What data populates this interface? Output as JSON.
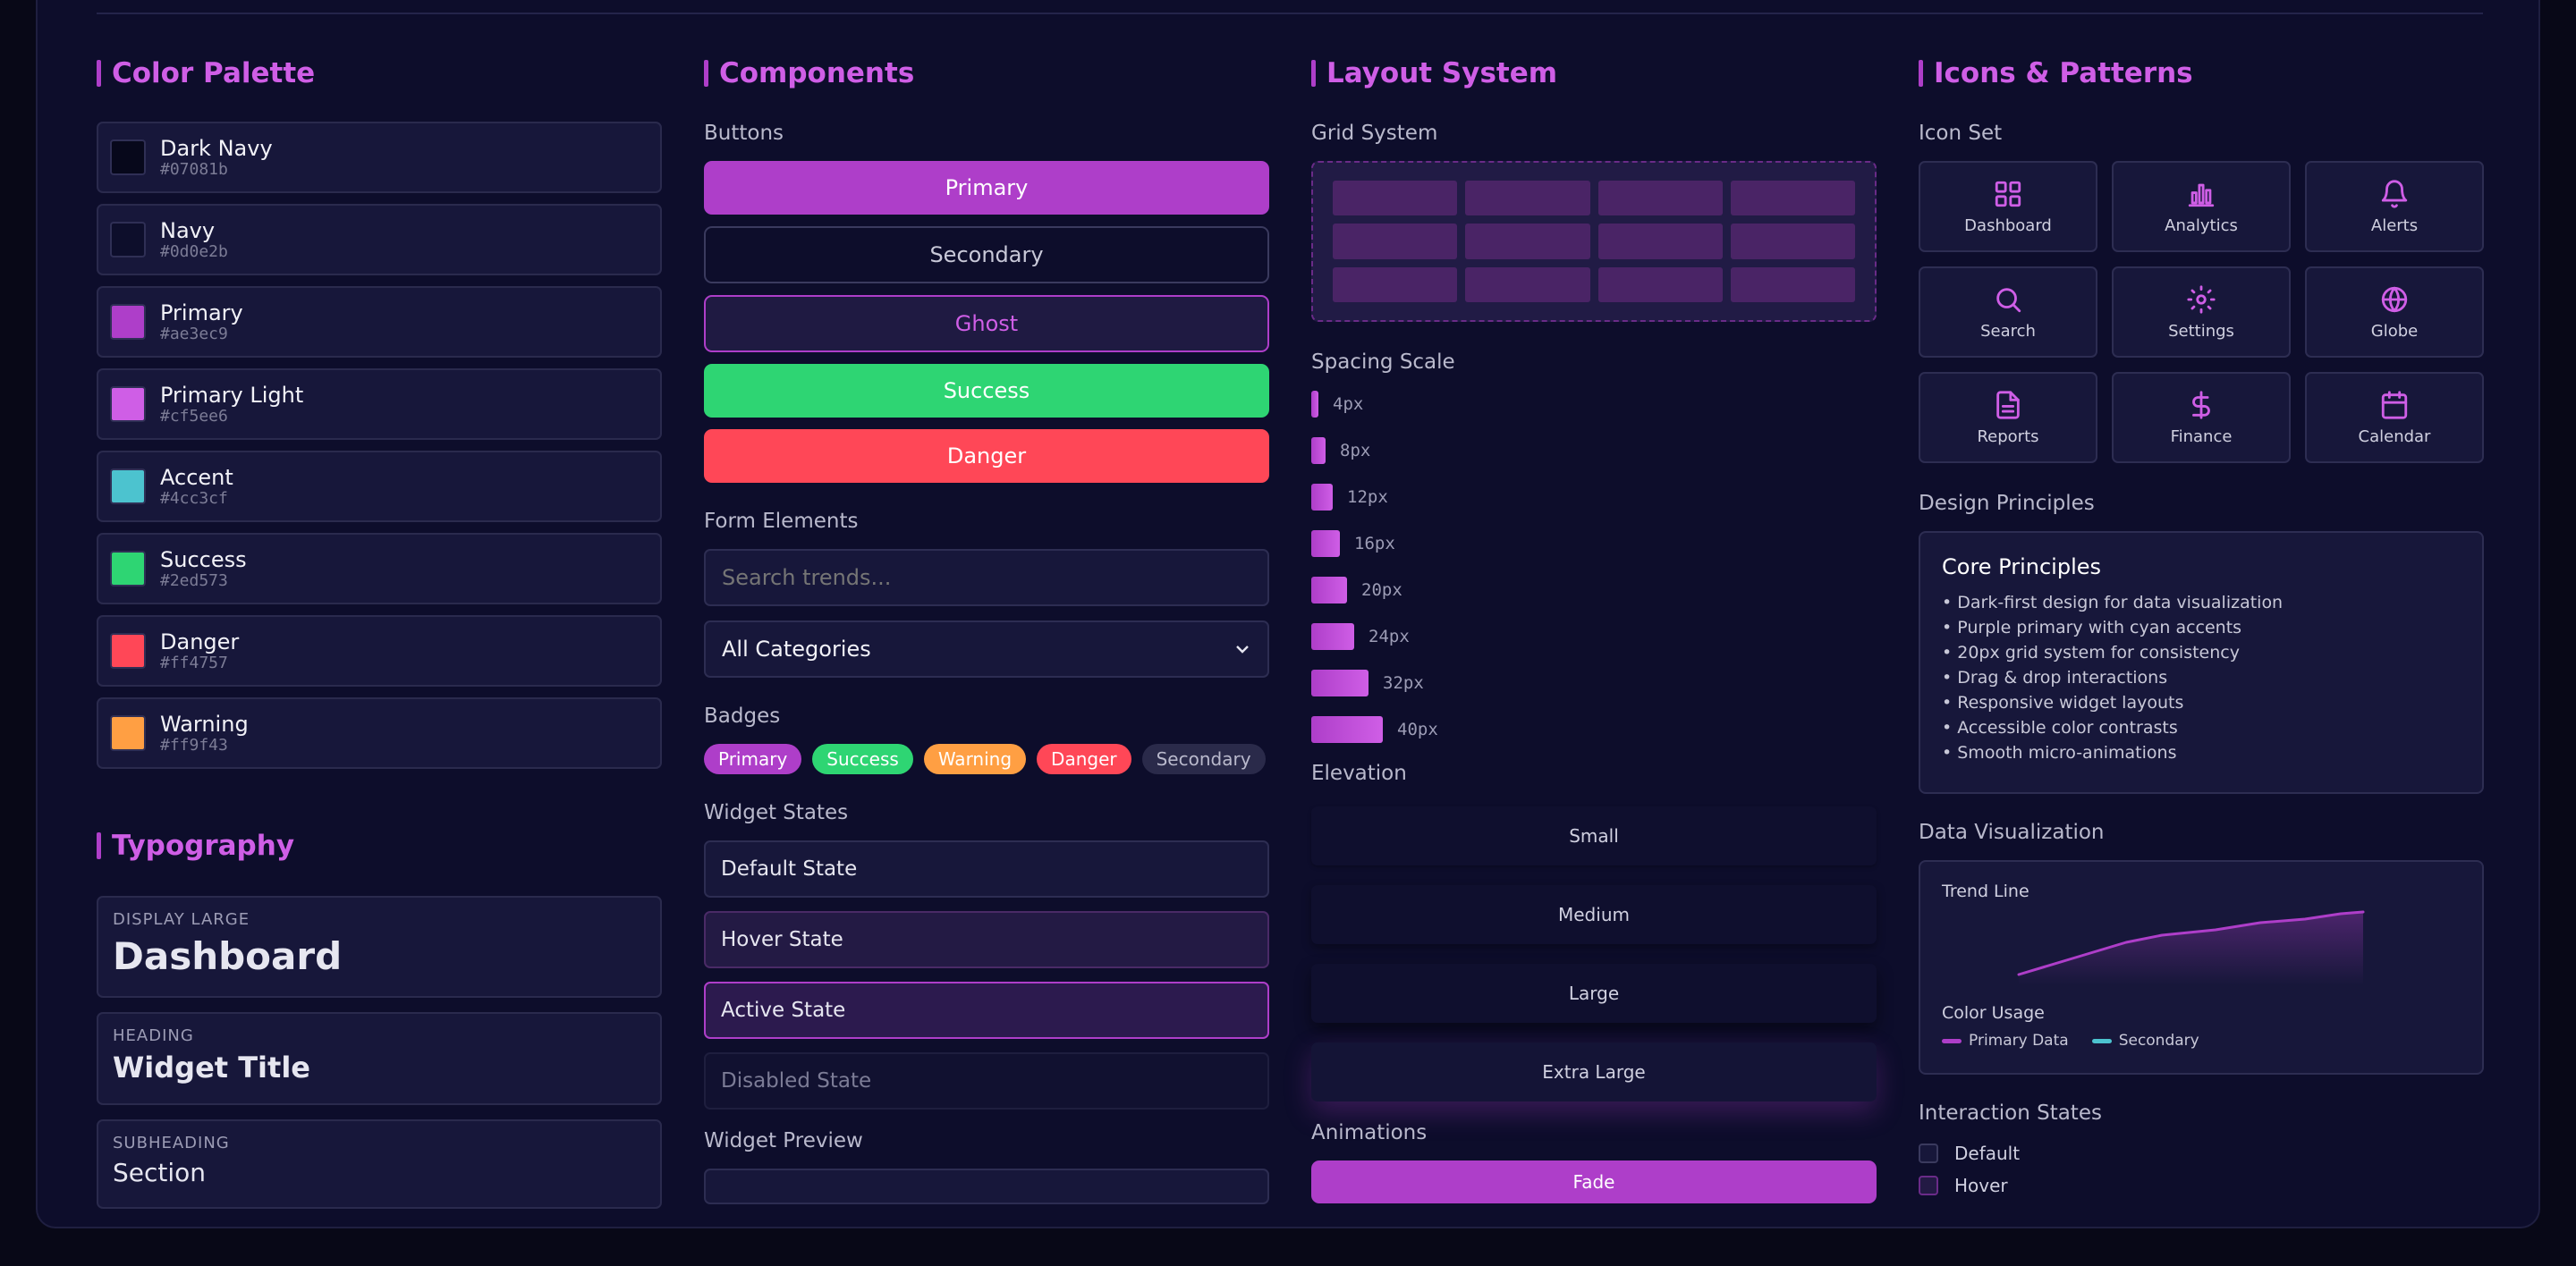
{
  "palette": {
    "title": "Color Palette",
    "swatches": [
      {
        "name": "Dark Navy",
        "hex": "#07081b"
      },
      {
        "name": "Navy",
        "hex": "#0d0e2b"
      },
      {
        "name": "Primary",
        "hex": "#ae3ec9"
      },
      {
        "name": "Primary Light",
        "hex": "#cf5ee6"
      },
      {
        "name": "Accent",
        "hex": "#4cc3cf"
      },
      {
        "name": "Success",
        "hex": "#2ed573"
      },
      {
        "name": "Danger",
        "hex": "#ff4757"
      },
      {
        "name": "Warning",
        "hex": "#ff9f43"
      }
    ]
  },
  "typography": {
    "title": "Typography",
    "samples": [
      {
        "label": "DISPLAY LARGE",
        "text": "Dashboard"
      },
      {
        "label": "HEADING",
        "text": "Widget Title"
      },
      {
        "label": "SUBHEADING",
        "text": "Section"
      }
    ]
  },
  "components": {
    "title": "Components",
    "buttons_label": "Buttons",
    "buttons": [
      "Primary",
      "Secondary",
      "Ghost",
      "Success",
      "Danger"
    ],
    "form_label": "Form Elements",
    "search_placeholder": "Search trends...",
    "select_value": "All Categories",
    "badges_label": "Badges",
    "badges": [
      "Primary",
      "Success",
      "Warning",
      "Danger",
      "Secondary"
    ],
    "states_label": "Widget States",
    "states": [
      "Default State",
      "Hover State",
      "Active State",
      "Disabled State"
    ],
    "preview_label": "Widget Preview"
  },
  "layout": {
    "title": "Layout System",
    "grid_label": "Grid System",
    "spacing_label": "Spacing Scale",
    "spacing": [
      "4px",
      "8px",
      "12px",
      "16px",
      "20px",
      "24px",
      "32px",
      "40px"
    ],
    "elevation_label": "Elevation",
    "elevation": [
      "Small",
      "Medium",
      "Large",
      "Extra Large"
    ],
    "animations_label": "Animations",
    "animation_button": "Fade"
  },
  "icons": {
    "title": "Icons & Patterns",
    "set_label": "Icon Set",
    "items": [
      {
        "label": "Dashboard",
        "icon": "dashboard-icon"
      },
      {
        "label": "Analytics",
        "icon": "analytics-icon"
      },
      {
        "label": "Alerts",
        "icon": "bell-icon"
      },
      {
        "label": "Search",
        "icon": "search-icon"
      },
      {
        "label": "Settings",
        "icon": "gear-icon"
      },
      {
        "label": "Globe",
        "icon": "globe-icon"
      },
      {
        "label": "Reports",
        "icon": "file-icon"
      },
      {
        "label": "Finance",
        "icon": "dollar-icon"
      },
      {
        "label": "Calendar",
        "icon": "calendar-icon"
      }
    ],
    "principles_label": "Design Principles",
    "principles_title": "Core Principles",
    "principles": [
      "• Dark-first design for data visualization",
      "• Purple primary with cyan accents",
      "• 20px grid system for consistency",
      "• Drag & drop interactions",
      "• Responsive widget layouts",
      "• Accessible color contrasts",
      "• Smooth micro-animations"
    ],
    "dataviz_label": "Data Visualization",
    "trend_title": "Trend Line",
    "color_usage": "Color Usage",
    "legend": [
      "Primary Data",
      "Secondary"
    ],
    "interaction_label": "Interaction States",
    "interactions": [
      "Default",
      "Hover"
    ]
  },
  "colors": {
    "primary": "#ae3ec9",
    "primary_light": "#cf5ee6",
    "accent": "#4cc3cf",
    "success": "#2ed573",
    "danger": "#ff4757",
    "warning": "#ff9f43"
  }
}
